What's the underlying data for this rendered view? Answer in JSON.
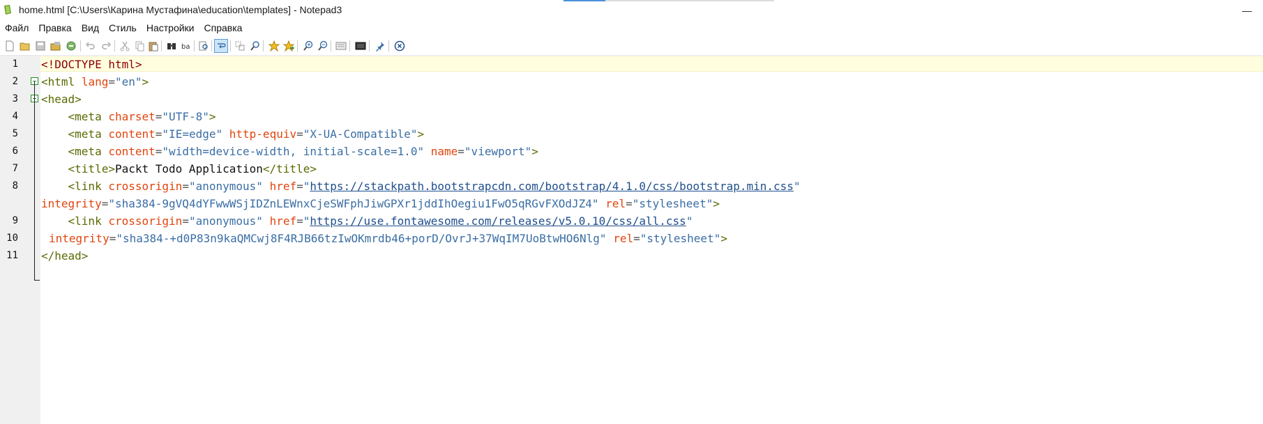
{
  "window": {
    "title": "home.html [C:\\Users\\Карина Мустафина\\education\\templates] - Notepad3",
    "minimize_glyph": "—"
  },
  "menu": [
    "Файл",
    "Правка",
    "Вид",
    "Стиль",
    "Настройки",
    "Справка"
  ],
  "toolbar_icons": [
    "new-file-icon",
    "open-folder-icon",
    "save-icon",
    "save-as-icon",
    "browse-icon",
    "undo-icon",
    "redo-icon",
    "cut-icon",
    "copy-icon",
    "paste-icon",
    "find-icon",
    "replace-icon",
    "find-file-icon",
    "word-wrap-icon",
    "select-icon",
    "zoom-find-icon",
    "bookmark-icon",
    "bookmark-next-icon",
    "zoom-in-icon",
    "zoom-out-icon",
    "view-icon",
    "screen-icon",
    "pin-icon",
    "close-icon"
  ],
  "editor": {
    "line_numbers": [
      "1",
      "2",
      "3",
      "4",
      "5",
      "6",
      "7",
      "8",
      "9",
      "10",
      "11"
    ],
    "lines": {
      "l1": {
        "open": "<!DOCTYPE html>"
      },
      "l2": {
        "tag": "<html",
        "attr1": "lang",
        "val1": "\"en\"",
        "close": ">"
      },
      "l3": {
        "tag": "<head>"
      },
      "l4": {
        "indent": "    ",
        "tag": "<meta",
        "attr1": "charset",
        "val1": "\"UTF-8\"",
        "close": ">"
      },
      "l5": {
        "indent": "    ",
        "tag": "<meta",
        "attr1": "content",
        "val1": "\"IE=edge\"",
        "attr2": "http-equiv",
        "val2": "\"X-UA-Compatible\"",
        "close": ">"
      },
      "l6": {
        "indent": "    ",
        "tag": "<meta",
        "attr1": "content",
        "val1": "\"width=device-width, initial-scale=1.0\"",
        "attr2": "name",
        "val2": "\"viewport\"",
        "close": ">"
      },
      "l7": {
        "indent": "    ",
        "tag_open": "<title>",
        "text": "Packt Todo Application",
        "tag_close": "</title>",
        "close": ">"
      },
      "l8": {
        "indent": "    ",
        "tag": "<link",
        "attr1": "crossorigin",
        "val1": "\"anonymous\"",
        "attr2": "href",
        "q_open": "\"",
        "url": "https://stackpath.bootstrapcdn.com/bootstrap/4.1.0/css/bootstrap.min.css",
        "q_close": "\""
      },
      "l8b": {
        "attr1": "integrity",
        "val1": "\"sha384-9gVQ4dYFwwWSjIDZnLEWnxCjeSWFphJiwGPXr1jddIhOegiu1FwO5qRGvFXOdJZ4\"",
        "attr2": "rel",
        "val2": "\"stylesheet\"",
        "close": ">"
      },
      "l9": {
        "indent": "    ",
        "tag": "<link",
        "attr1": "crossorigin",
        "val1": "\"anonymous\"",
        "attr2": "href",
        "q_open": "\"",
        "url": "https://use.fontawesome.com/releases/v5.0.10/css/all.css",
        "q_close": "\""
      },
      "l10": {
        "attr1": "integrity",
        "val1": "\"sha384-+d0P83n9kaQMCwj8F4RJB66tzIwOKmrdb46+porD/OvrJ+37WqIM7UoBtwHO6Nlg\"",
        "attr2": "rel",
        "val2": "\"stylesheet\"",
        "close": ">"
      },
      "l11": {
        "tag": "</head>"
      }
    }
  },
  "colors": {
    "tag": "#5a6a00",
    "attribute": "#e0450e",
    "string": "#3a6ea5",
    "url": "#1f4e8c",
    "current_line": "#ffffe0",
    "gutter": "#f0f0f0"
  }
}
